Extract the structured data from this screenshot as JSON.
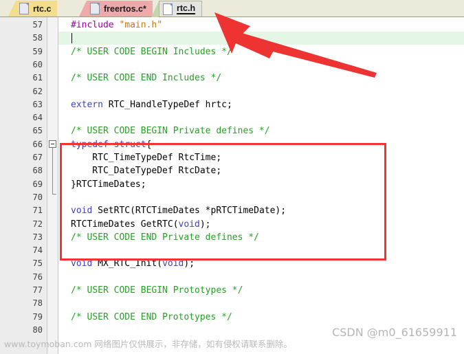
{
  "tabs": [
    {
      "label": "rtc.c",
      "icon": "file-icon",
      "active": false,
      "modified": false,
      "color": "#f5dd8e"
    },
    {
      "label": "freertos.c*",
      "icon": "file-icon",
      "active": false,
      "modified": true,
      "color": "#eeaaaa"
    },
    {
      "label": "rtc.h",
      "icon": "file-icon",
      "active": true,
      "modified": false,
      "color": "#e3e3e0"
    }
  ],
  "editor": {
    "first_line": 57,
    "current_line": 58,
    "fold_marker_line": 66,
    "lines": [
      {
        "n": "57",
        "segs": [
          {
            "t": "#include ",
            "c": "pre"
          },
          {
            "t": "\"main.h\"",
            "c": "str"
          }
        ]
      },
      {
        "n": "58",
        "segs": []
      },
      {
        "n": "59",
        "segs": [
          {
            "t": "/* USER CODE BEGIN Includes */",
            "c": "cmt"
          }
        ]
      },
      {
        "n": "60",
        "segs": []
      },
      {
        "n": "61",
        "segs": [
          {
            "t": "/* USER CODE END Includes */",
            "c": "cmt"
          }
        ]
      },
      {
        "n": "62",
        "segs": []
      },
      {
        "n": "63",
        "segs": [
          {
            "t": "extern",
            "c": "kw"
          },
          {
            "t": " RTC_HandleTypeDef hrtc;",
            "c": ""
          }
        ]
      },
      {
        "n": "64",
        "segs": []
      },
      {
        "n": "65",
        "segs": [
          {
            "t": "/* USER CODE BEGIN Private defines */",
            "c": "cmt"
          }
        ]
      },
      {
        "n": "66",
        "segs": [
          {
            "t": "typedef struct",
            "c": "kw"
          },
          {
            "t": "{",
            "c": ""
          }
        ]
      },
      {
        "n": "67",
        "segs": [
          {
            "t": "    RTC_TimeTypeDef RtcTime;",
            "c": ""
          }
        ]
      },
      {
        "n": "68",
        "segs": [
          {
            "t": "    RTC_DateTypeDef RtcDate;",
            "c": ""
          }
        ]
      },
      {
        "n": "69",
        "segs": [
          {
            "t": "}RTCTimeDates;",
            "c": ""
          }
        ]
      },
      {
        "n": "70",
        "segs": []
      },
      {
        "n": "71",
        "segs": [
          {
            "t": "void",
            "c": "kw"
          },
          {
            "t": " SetRTC(RTCTimeDates *pRTCTimeDate);",
            "c": ""
          }
        ]
      },
      {
        "n": "72",
        "segs": [
          {
            "t": "RTCTimeDates GetRTC(",
            "c": ""
          },
          {
            "t": "void",
            "c": "kw"
          },
          {
            "t": ");",
            "c": ""
          }
        ]
      },
      {
        "n": "73",
        "segs": [
          {
            "t": "/* USER CODE END Private defines */",
            "c": "cmt"
          }
        ]
      },
      {
        "n": "74",
        "segs": []
      },
      {
        "n": "75",
        "segs": [
          {
            "t": "void",
            "c": "kw"
          },
          {
            "t": " MX_RTC_Init(",
            "c": ""
          },
          {
            "t": "void",
            "c": "kw"
          },
          {
            "t": ");",
            "c": ""
          }
        ]
      },
      {
        "n": "76",
        "segs": []
      },
      {
        "n": "77",
        "segs": [
          {
            "t": "/* USER CODE BEGIN Prototypes */",
            "c": "cmt"
          }
        ]
      },
      {
        "n": "78",
        "segs": []
      },
      {
        "n": "79",
        "segs": [
          {
            "t": "/* USER CODE END Prototypes */",
            "c": "cmt"
          }
        ]
      },
      {
        "n": "80",
        "segs": []
      }
    ]
  },
  "annotations": {
    "highlight_box": {
      "label": "red-highlight-box",
      "color": "#f73030"
    },
    "arrow": {
      "label": "red-arrow-pointing-to-rtc-h-tab",
      "color": "#ee3333"
    }
  },
  "watermarks": {
    "left": "www.toymoban.com 网络图片仅供展示，非存储，如有侵权请联系删除。",
    "right": "CSDN @m0_61659911"
  }
}
